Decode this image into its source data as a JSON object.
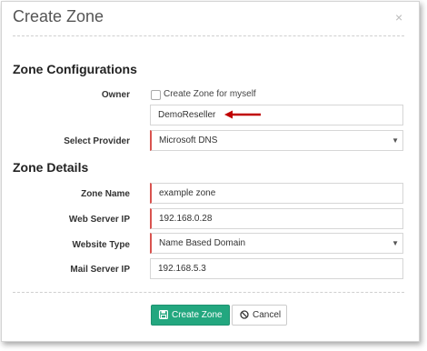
{
  "dialog": {
    "title": "Create Zone",
    "close_glyph": "×"
  },
  "sections": {
    "configurations": "Zone Configurations",
    "details": "Zone Details"
  },
  "owner": {
    "label": "Owner",
    "checkbox_label": "Create Zone for myself",
    "checked": false,
    "value": "DemoReseller"
  },
  "provider": {
    "label": "Select Provider",
    "value": "Microsoft DNS"
  },
  "zone_name": {
    "label": "Zone Name",
    "value": "example zone"
  },
  "web_server_ip": {
    "label": "Web Server IP",
    "value": "192.168.0.28"
  },
  "website_type": {
    "label": "Website Type",
    "value": "Name Based Domain"
  },
  "mail_server_ip": {
    "label": "Mail Server IP",
    "value": "192.168.5.3"
  },
  "buttons": {
    "create": "Create Zone",
    "cancel": "Cancel"
  },
  "colors": {
    "primary": "#23a77f",
    "required_border": "#d9534f",
    "annotation_arrow": "#c00000"
  },
  "icons": {
    "create": "save-icon",
    "cancel": "ban-icon",
    "select": "caret-down-icon",
    "close": "close-icon"
  }
}
